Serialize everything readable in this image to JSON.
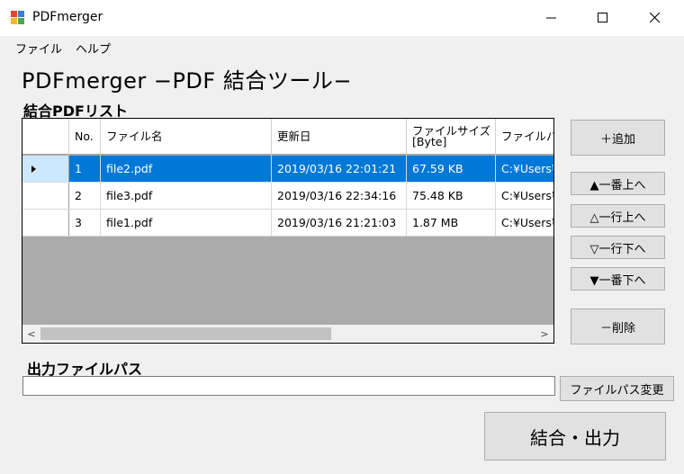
{
  "window": {
    "title": "PDFmerger",
    "controls": {
      "minimize": "minimize-icon",
      "maximize": "maximize-icon",
      "close": "close-icon"
    }
  },
  "menu": [
    "ファイル",
    "ヘルプ"
  ],
  "page_title": "PDFmerger −PDF 結合ツール−",
  "list_label": "結合PDFリスト",
  "grid": {
    "columns": [
      "No.",
      "ファイル名",
      "更新日",
      "ファイルサイズ\n[Byte]",
      "ファイルパ"
    ],
    "rows": [
      {
        "no": "1",
        "name": "file2.pdf",
        "date": "2019/03/16 22:01:21",
        "size": "67.59 KB",
        "path": "C:¥Users¥",
        "selected": true
      },
      {
        "no": "2",
        "name": "file3.pdf",
        "date": "2019/03/16 22:34:16",
        "size": "75.48 KB",
        "path": "C:¥Users¥",
        "selected": false
      },
      {
        "no": "3",
        "name": "file1.pdf",
        "date": "2019/03/16 21:21:03",
        "size": "1.87 MB",
        "path": "C:¥Users¥",
        "selected": false
      }
    ],
    "scroll_left": "<",
    "scroll_right": ">"
  },
  "buttons": {
    "add": "＋追加",
    "top": "▲一番上へ",
    "up": "△一行上へ",
    "down": "▽一行下へ",
    "bottom": "▼一番下へ",
    "delete": "－削除",
    "change_path": "ファイルパス変更",
    "merge": "結合・出力"
  },
  "output_label": "出力ファイルパス",
  "output_path": "",
  "colors": {
    "selection": "#0078d7",
    "row_header_selected": "#cce8ff",
    "grid_background": "#ababab"
  }
}
